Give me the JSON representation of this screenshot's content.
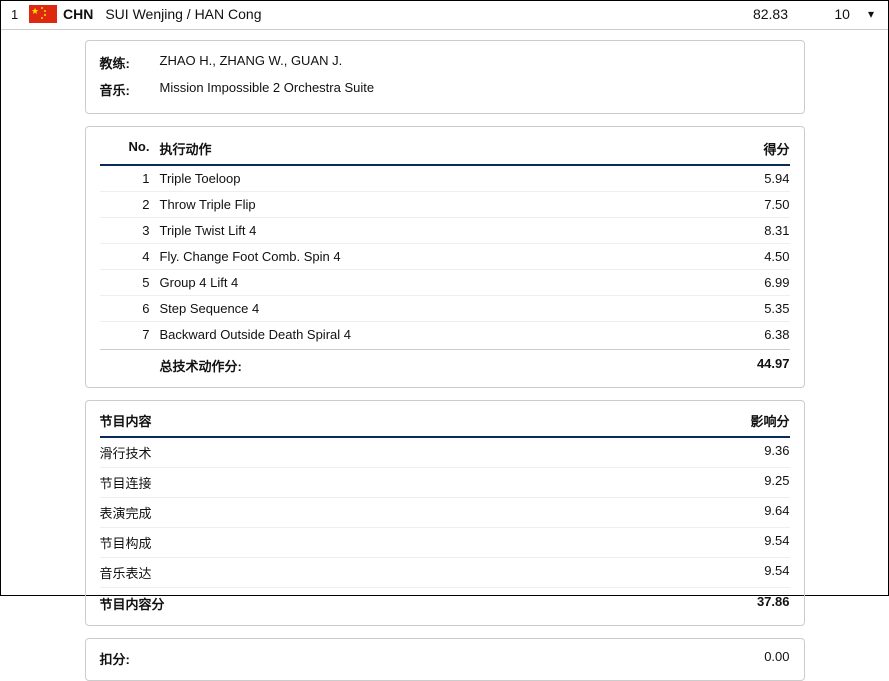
{
  "header": {
    "rank": "1",
    "country_code": "CHN",
    "pair_name": "SUI Wenjing / HAN Cong",
    "total_score": "82.83",
    "count": "10"
  },
  "info": {
    "coach_label": "教练:",
    "coach_value": "ZHAO H., ZHANG W., GUAN J.",
    "music_label": "音乐:",
    "music_value": "Mission Impossible 2 Orchestra Suite"
  },
  "elements": {
    "header_no": "No.",
    "header_name": "执行动作",
    "header_score": "得分",
    "rows": [
      {
        "no": "1",
        "name": "Triple Toeloop",
        "score": "5.94"
      },
      {
        "no": "2",
        "name": "Throw Triple Flip",
        "score": "7.50"
      },
      {
        "no": "3",
        "name": "Triple Twist Lift 4",
        "score": "8.31"
      },
      {
        "no": "4",
        "name": "Fly. Change Foot Comb. Spin 4",
        "score": "4.50"
      },
      {
        "no": "5",
        "name": "Group 4 Lift 4",
        "score": "6.99"
      },
      {
        "no": "6",
        "name": "Step Sequence 4",
        "score": "5.35"
      },
      {
        "no": "7",
        "name": "Backward Outside Death Spiral 4",
        "score": "6.38"
      }
    ],
    "total_label": "总技术动作分:",
    "total_value": "44.97"
  },
  "components": {
    "header_name": "节目内容",
    "header_score": "影响分",
    "rows": [
      {
        "name": "滑行技术",
        "score": "9.36"
      },
      {
        "name": "节目连接",
        "score": "9.25"
      },
      {
        "name": "表演完成",
        "score": "9.64"
      },
      {
        "name": "节目构成",
        "score": "9.54"
      },
      {
        "name": "音乐表达",
        "score": "9.54"
      }
    ],
    "total_label": "节目内容分",
    "total_value": "37.86"
  },
  "deductions": {
    "label": "扣分:",
    "value": "0.00"
  }
}
